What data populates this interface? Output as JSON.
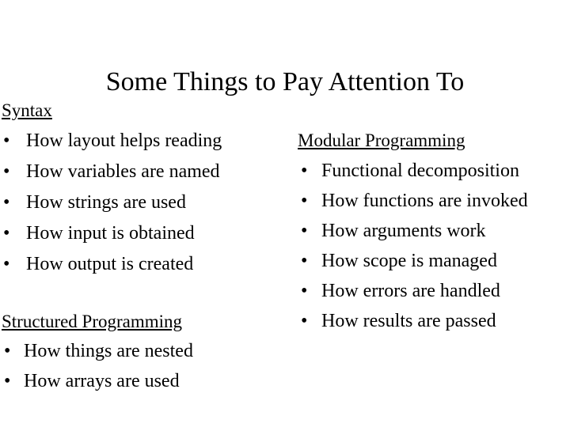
{
  "slide": {
    "title": "Some Things to Pay Attention To",
    "background_color": "#ffffff",
    "text_color": "#000000",
    "bullet_glyph": "•"
  },
  "left_column": {
    "sections": [
      {
        "heading": "Syntax",
        "items": [
          "How layout helps reading",
          "How variables are named",
          "How strings are used",
          "How input is obtained",
          "How output is created"
        ]
      },
      {
        "heading": "Structured Programming",
        "items": [
          "How things are nested",
          "How arrays are used"
        ]
      }
    ]
  },
  "right_column": {
    "sections": [
      {
        "heading": "Modular Programming",
        "items": [
          "Functional decomposition",
          "How functions are invoked",
          "How arguments work",
          "How scope is managed",
          "How errors are handled",
          "How results are passed"
        ]
      }
    ]
  }
}
